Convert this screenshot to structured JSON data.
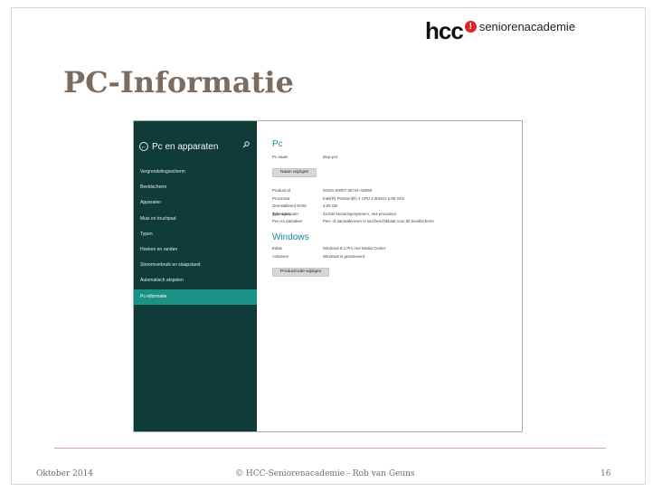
{
  "logo": {
    "brand": "hcc",
    "dot": "!",
    "sub": "seniorenacademie"
  },
  "slide": {
    "title": "PC-Informatie"
  },
  "sidebar": {
    "title": "Pc en apparaten",
    "items": [
      {
        "label": "Vergrendelingsscherm"
      },
      {
        "label": "Beeldscherm"
      },
      {
        "label": "Apparaten"
      },
      {
        "label": "Muis en touchpad"
      },
      {
        "label": "Typen"
      },
      {
        "label": "Hoeken en randen"
      },
      {
        "label": "Stroomverbruik en slaapstand"
      },
      {
        "label": "Automatisch afspelen"
      },
      {
        "label": "Pc-informatie"
      }
    ]
  },
  "pc": {
    "heading": "Pc",
    "name_label": "Pc-naam",
    "name_value": "dtop-pr4",
    "rename_button": "Naam wijzigen",
    "specs": [
      {
        "k": "Product-id",
        "v": "00181-00007-35744-AB063"
      },
      {
        "k": "Processor",
        "v": "Intel(R) Pentium(R) 4 CPU 3.00GHz   2.99 GHz"
      },
      {
        "k": "Geïnstalleerd RAM-geheugen",
        "v": "3,00 GB"
      },
      {
        "k": "Type computer",
        "v": "32-bits besturingssysteem, x64-processor"
      },
      {
        "k": "Pen en aanraken",
        "v": "Pen- of aanraakinvoer is niet beschikbaar voor dit beeldscherm"
      }
    ]
  },
  "windows": {
    "heading": "Windows",
    "rows": [
      {
        "k": "Editie",
        "v": "Windows 8.1 Pro met Media Center"
      },
      {
        "k": "Activeren",
        "v": "Windows is geactiveerd"
      }
    ],
    "productkey_button": "Productcode wijzigen"
  },
  "footer": {
    "date": "Oktober 2014",
    "copyright": "© HCC-Seniorenacademie - Rob van Geuns",
    "page": "16"
  },
  "colors": {
    "sidebar_bg": "#0f3b39",
    "sidebar_active": "#1a9186",
    "heading_blue": "#1a8aa0",
    "title_brown": "#7b6c5f",
    "footer_line": "#d2a79a"
  }
}
